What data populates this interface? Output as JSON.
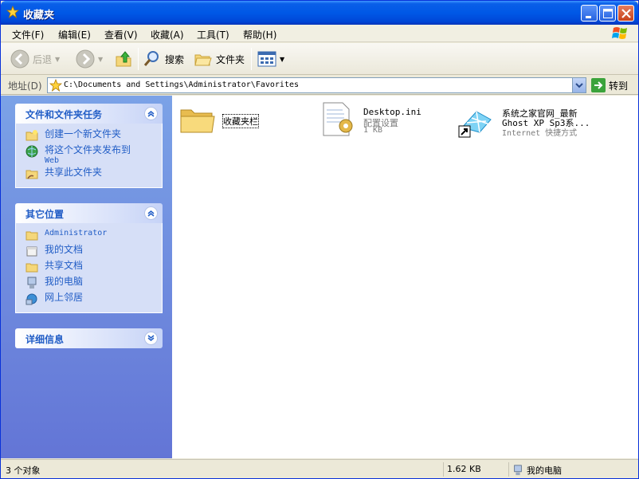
{
  "window": {
    "title": "收藏夹"
  },
  "menu": [
    "文件(F)",
    "编辑(E)",
    "查看(V)",
    "收藏(A)",
    "工具(T)",
    "帮助(H)"
  ],
  "toolbar": {
    "back": "后退",
    "search": "搜索",
    "folders": "文件夹"
  },
  "address": {
    "label": "地址(D)",
    "value": "C:\\Documents and Settings\\Administrator\\Favorites",
    "go": "转到"
  },
  "tasks_panel": {
    "title": "文件和文件夹任务",
    "items": [
      {
        "label": "创建一个新文件夹",
        "icon": "new-folder-icon"
      },
      {
        "label": "将这个文件夹发布到",
        "label2": "Web",
        "icon": "publish-web-icon"
      },
      {
        "label": "共享此文件夹",
        "icon": "share-folder-icon"
      }
    ]
  },
  "places_panel": {
    "title": "其它位置",
    "items": [
      {
        "label": "Administrator",
        "icon": "folder-icon"
      },
      {
        "label": "我的文档",
        "icon": "documents-icon"
      },
      {
        "label": "共享文档",
        "icon": "folder-icon"
      },
      {
        "label": "我的电脑",
        "icon": "computer-icon"
      },
      {
        "label": "网上邻居",
        "icon": "network-icon"
      }
    ]
  },
  "details_panel": {
    "title": "详细信息"
  },
  "files": [
    {
      "name": "收藏夹栏",
      "icon": "folder-icon"
    },
    {
      "name": "Desktop.ini",
      "type": "配置设置",
      "size": "1 KB",
      "icon": "config-file-icon"
    },
    {
      "name": "系统之家官网_最新",
      "name2": "Ghost XP Sp3系...",
      "type": "Internet 快捷方式",
      "icon": "internet-shortcut-icon"
    }
  ],
  "status": {
    "count": "3 个对象",
    "size": "1.62 KB",
    "location": "我的电脑"
  },
  "colors": {
    "titlebar": "#0058E6",
    "taskpane": "#6B8CDF",
    "link": "#215DC6"
  }
}
